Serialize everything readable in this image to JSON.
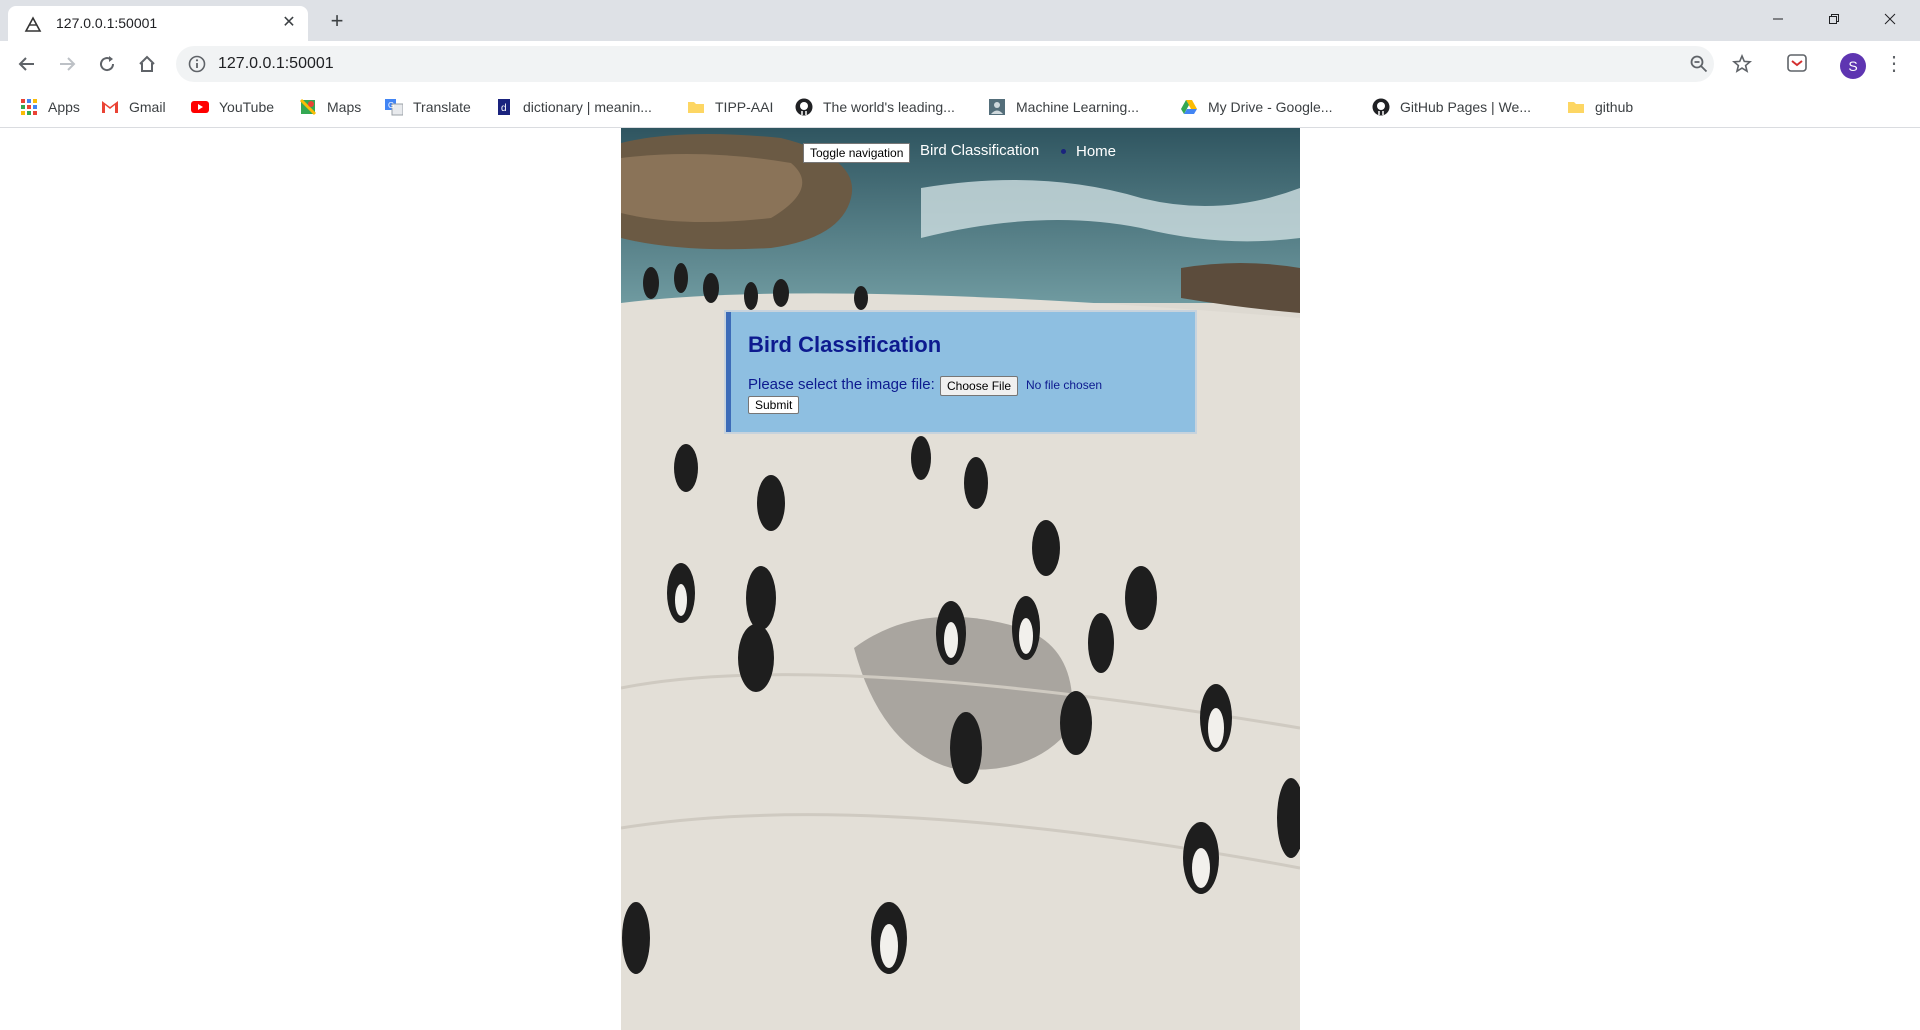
{
  "browser": {
    "tab_title": "127.0.0.1:50001",
    "url": "127.0.0.1:50001",
    "profile_initial": "S"
  },
  "bookmarks": [
    {
      "label": "Apps",
      "icon": "apps-grid-icon"
    },
    {
      "label": "Gmail",
      "icon": "gmail-icon"
    },
    {
      "label": "YouTube",
      "icon": "youtube-icon"
    },
    {
      "label": "Maps",
      "icon": "maps-icon"
    },
    {
      "label": "Translate",
      "icon": "translate-icon"
    },
    {
      "label": "dictionary | meanin...",
      "icon": "dictionary-icon"
    },
    {
      "label": "TIPP-AAI",
      "icon": "folder-icon"
    },
    {
      "label": "The world's leading...",
      "icon": "github-icon"
    },
    {
      "label": "Machine Learning...",
      "icon": "ml-page-icon"
    },
    {
      "label": "My Drive - Google...",
      "icon": "google-drive-icon"
    },
    {
      "label": "GitHub Pages | We...",
      "icon": "github-icon"
    },
    {
      "label": "github",
      "icon": "folder-icon"
    }
  ],
  "navbar": {
    "toggle_label": "Toggle navigation",
    "brand": "Bird Classification",
    "home_link": "Home"
  },
  "form": {
    "title": "Bird Classification",
    "label": "Please select the image file:",
    "file_button": "Choose File",
    "file_status": "No file chosen",
    "submit": "Submit"
  },
  "colors": {
    "form_bg": "#87bce2",
    "form_text": "#0d1a8f",
    "tabstrip": "#dee1e6"
  }
}
